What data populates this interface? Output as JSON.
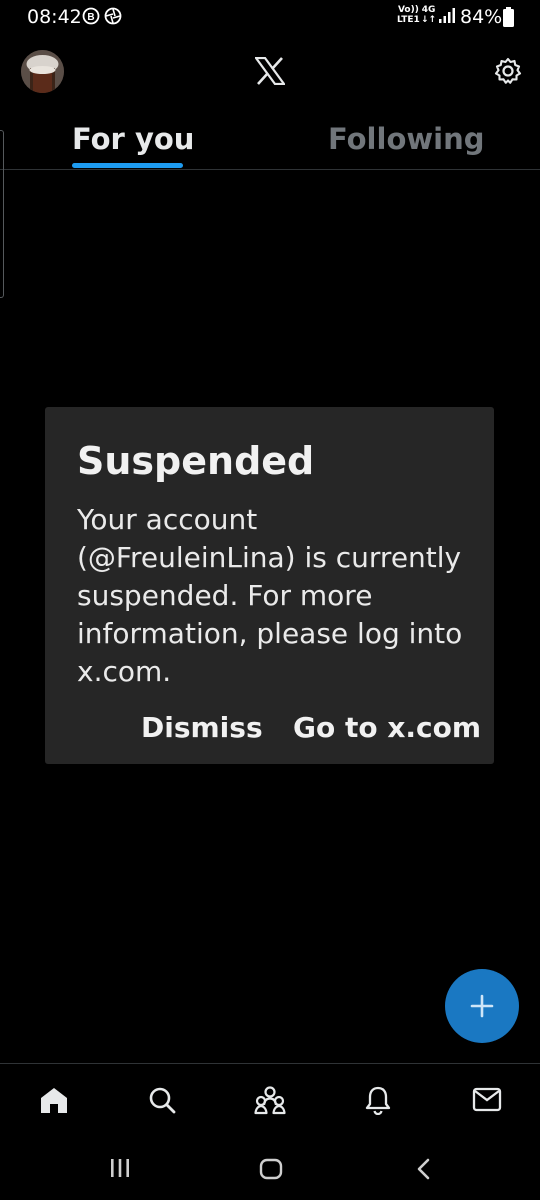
{
  "status_bar": {
    "time": "08:42",
    "network_top": "Vo))",
    "network_bottom": "LTE1",
    "network_type": "4G",
    "battery": "84%",
    "icons": [
      "b-circle-icon",
      "shutter-icon",
      "signal-icon",
      "battery-icon"
    ]
  },
  "header": {
    "logo_icon": "x-logo-icon",
    "settings_icon": "gear-icon"
  },
  "tabs": [
    {
      "label": "For you",
      "active": true
    },
    {
      "label": "Following",
      "active": false
    }
  ],
  "dialog": {
    "title": "Suspended",
    "message": "Your account (@FreuleinLina) is currently suspended. For more information, please log into x.com.",
    "dismiss": "Dismiss",
    "goto": "Go to x.com"
  },
  "fab": {
    "icon": "plus-icon"
  },
  "bottom_nav": [
    "home-icon",
    "search-icon",
    "communities-icon",
    "notifications-icon",
    "messages-icon"
  ],
  "system_nav": [
    "recents-icon",
    "home-circle-icon",
    "back-icon"
  ],
  "colors": {
    "background": "#000000",
    "accent": "#1d9bf0",
    "fab": "#1a78c2",
    "dialog_bg": "#262626",
    "inactive_text": "#71767b"
  }
}
